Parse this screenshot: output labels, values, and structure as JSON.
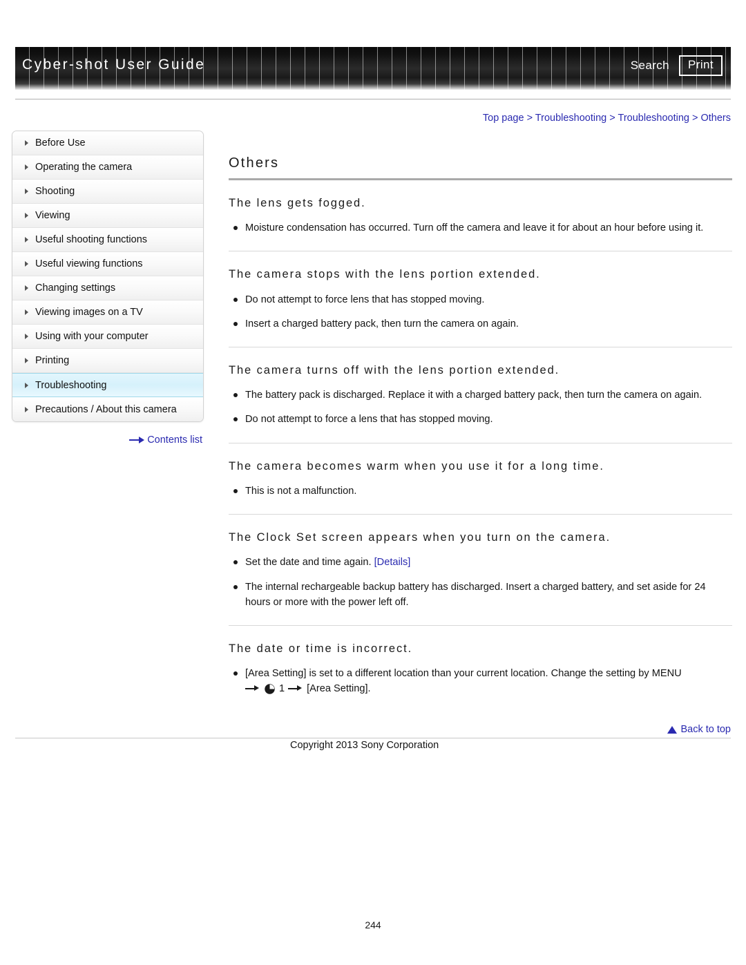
{
  "header": {
    "title": "Cyber-shot User Guide",
    "search_label": "Search",
    "print_label": "Print"
  },
  "breadcrumb": {
    "text": "Top page > Troubleshooting > Troubleshooting > Others"
  },
  "sidebar": {
    "items": [
      {
        "label": "Before Use",
        "active": false
      },
      {
        "label": "Operating the camera",
        "active": false
      },
      {
        "label": "Shooting",
        "active": false
      },
      {
        "label": "Viewing",
        "active": false
      },
      {
        "label": "Useful shooting functions",
        "active": false
      },
      {
        "label": "Useful viewing functions",
        "active": false
      },
      {
        "label": "Changing settings",
        "active": false
      },
      {
        "label": "Viewing images on a TV",
        "active": false
      },
      {
        "label": "Using with your computer",
        "active": false
      },
      {
        "label": "Printing",
        "active": false
      },
      {
        "label": "Troubleshooting",
        "active": true
      },
      {
        "label": "Precautions / About this camera",
        "active": false
      }
    ],
    "contents_list_label": "Contents list"
  },
  "main": {
    "page_title": "Others",
    "sections": [
      {
        "heading": "The lens gets fogged.",
        "bullets": [
          {
            "text": "Moisture condensation has occurred. Turn off the camera and leave it for about an hour before using it."
          }
        ]
      },
      {
        "heading": "The camera stops with the lens portion extended.",
        "bullets": [
          {
            "text": "Do not attempt to force lens that has stopped moving."
          },
          {
            "text": "Insert a charged battery pack, then turn the camera on again."
          }
        ]
      },
      {
        "heading": "The camera turns off with the lens portion extended.",
        "bullets": [
          {
            "text": "The battery pack is discharged. Replace it with a charged battery pack, then turn the camera on again."
          },
          {
            "text": "Do not attempt to force a lens that has stopped moving."
          }
        ]
      },
      {
        "heading": "The camera becomes warm when you use it for a long time.",
        "bullets": [
          {
            "text": "This is not a malfunction."
          }
        ]
      },
      {
        "heading": "The Clock Set screen appears when you turn on the camera.",
        "bullets": [
          {
            "text": "Set the date and time again.",
            "link": "[Details]"
          },
          {
            "text": "The internal rechargeable backup battery has discharged. Insert a charged battery, and set aside for 24 hours or more with the power left off."
          }
        ]
      },
      {
        "heading": "The date or time is incorrect.",
        "bullets": [
          {
            "text": "[Area Setting] is set to a different location than your current location. Change the setting by MENU",
            "path_step_number": "1",
            "path_end": "[Area Setting]."
          }
        ]
      }
    ]
  },
  "footer": {
    "back_to_top_label": "Back to top",
    "copyright": "Copyright 2013 Sony Corporation",
    "page_number": "244"
  },
  "colors": {
    "link": "#2a2ab0",
    "header_bg": "#1a1a1a",
    "active_nav": "#d6f1fb"
  }
}
